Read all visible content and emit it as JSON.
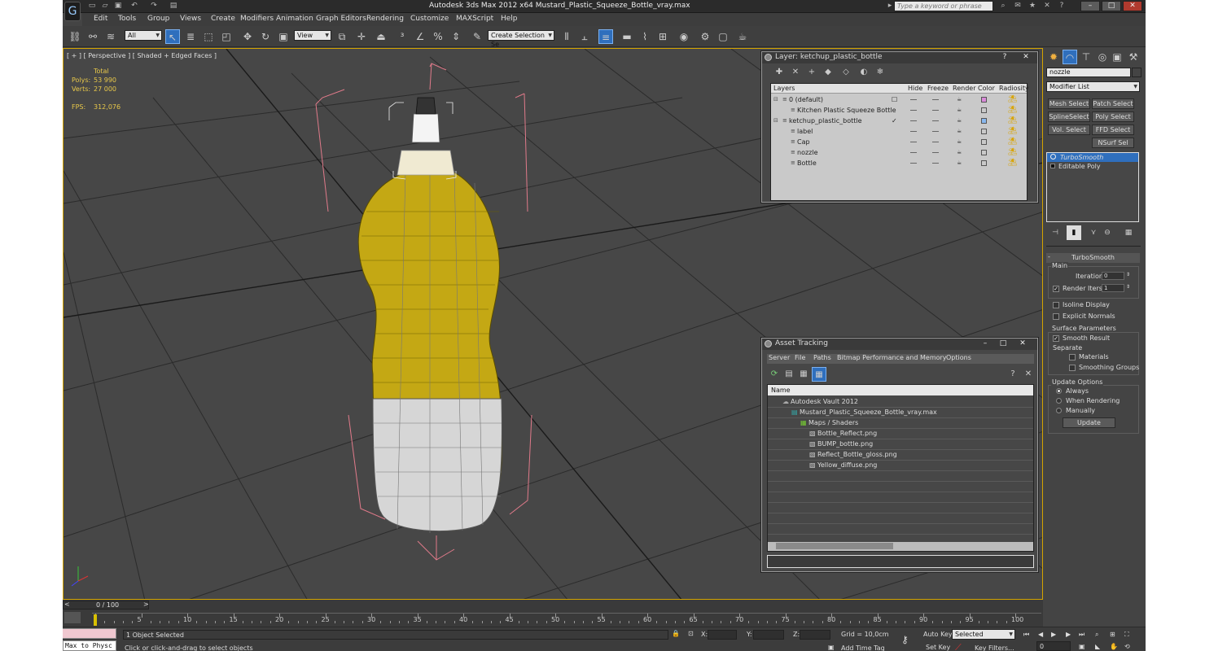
{
  "window": {
    "title": "Autodesk 3ds Max  2012 x64     Mustard_Plastic_Squeeze_Bottle_vray.max",
    "search_placeholder": "Type a keyword or phrase",
    "app_logo": "G"
  },
  "menu": [
    "Edit",
    "Tools",
    "Group",
    "Views",
    "Create",
    "Modifiers",
    "Animation",
    "Graph Editors",
    "Rendering",
    "Customize",
    "MAXScript",
    "Help"
  ],
  "toolbar": {
    "selection_filter": "All",
    "ref_coord": "View",
    "named_selection": "Create Selection Se"
  },
  "viewport": {
    "label": "[ + ] [ Perspective ] [ Shaded + Edged Faces ]",
    "stats": {
      "header": "Total",
      "polys_label": "Polys:",
      "polys_value": "53 990",
      "verts_label": "Verts:",
      "verts_value": "27 000",
      "fps_label": "FPS:",
      "fps_value": "312,076"
    }
  },
  "layer_manager": {
    "title": "Layer: ketchup_plastic_bottle",
    "help": "?",
    "close": "✕",
    "columns": [
      "Layers",
      "Hide",
      "Freeze",
      "Render",
      "Color",
      "Radiosity"
    ],
    "rows": [
      {
        "name": "0 (default)",
        "indent": 0,
        "color": "#d98ad9",
        "check": "☐"
      },
      {
        "name": "Kitchen Plastic Squeeze Bottle",
        "indent": 1,
        "color": "",
        "check": ""
      },
      {
        "name": "ketchup_plastic_bottle",
        "indent": 0,
        "color": "#89b8ee",
        "check": "✓"
      },
      {
        "name": "label",
        "indent": 1,
        "color": "",
        "check": ""
      },
      {
        "name": "Cap",
        "indent": 1,
        "color": "",
        "check": ""
      },
      {
        "name": "nozzle",
        "indent": 1,
        "color": "",
        "check": ""
      },
      {
        "name": "Bottle",
        "indent": 1,
        "color": "",
        "check": ""
      }
    ]
  },
  "asset_tracking": {
    "title": "Asset Tracking",
    "menu": [
      "Server",
      "File",
      "Paths",
      "Bitmap Performance and Memory",
      "Options"
    ],
    "column": "Name",
    "items": [
      {
        "name": "Autodesk Vault 2012",
        "level": 0
      },
      {
        "name": "Mustard_Plastic_Squeeze_Bottle_vray.max",
        "level": 1
      },
      {
        "name": "Maps / Shaders",
        "level": 2
      },
      {
        "name": "Bottle_Reflect.png",
        "level": 3
      },
      {
        "name": "BUMP_bottle.png",
        "level": 3
      },
      {
        "name": "Reflect_Bottle_gloss.png",
        "level": 3
      },
      {
        "name": "Yellow_diffuse.png",
        "level": 3
      }
    ]
  },
  "command_panel": {
    "object_name": "nozzle",
    "modifier_list": "Modifier List",
    "buttons": [
      [
        "Mesh Select",
        "Patch Select"
      ],
      [
        "SplineSelect",
        "Poly Select"
      ],
      [
        "Vol. Select",
        "FFD Select"
      ],
      [
        "",
        "NSurf Sel"
      ]
    ],
    "stack": [
      "TurboSmooth",
      "Editable Poly"
    ],
    "rollout_title": "TurboSmooth",
    "main_label": "Main",
    "iterations_label": "Iterations:",
    "iterations_value": "0",
    "render_iters_label": "Render Iters:",
    "render_iters_value": "1",
    "isoline_label": "Isoline Display",
    "explicit_label": "Explicit Normals",
    "surface_label": "Surface Parameters",
    "smooth_result_label": "Smooth Result",
    "separate_label": "Separate",
    "materials_label": "Materials",
    "smoothing_groups_label": "Smoothing Groups",
    "update_options_label": "Update Options",
    "always_label": "Always",
    "when_rendering_label": "When Rendering",
    "manually_label": "Manually",
    "update_button": "Update"
  },
  "timeline": {
    "frame": "0 / 100",
    "ticks": [
      "5",
      "10",
      "15",
      "20",
      "25",
      "30",
      "35",
      "40",
      "45",
      "50",
      "55",
      "60",
      "65",
      "70",
      "75",
      "80",
      "85",
      "90",
      "95",
      "100"
    ]
  },
  "status": {
    "maxscript": "Max to Physc",
    "selected": "1 Object Selected",
    "prompt": "Click or click-and-drag to select objects",
    "x_label": "X:",
    "y_label": "Y:",
    "z_label": "Z:",
    "grid": "Grid = 10,0cm",
    "add_time_tag": "Add Time Tag",
    "auto_key": "Auto Key",
    "set_key": "Set Key",
    "key_mode": "Selected",
    "key_filters": "Key Filters...",
    "frame_value": "0"
  }
}
